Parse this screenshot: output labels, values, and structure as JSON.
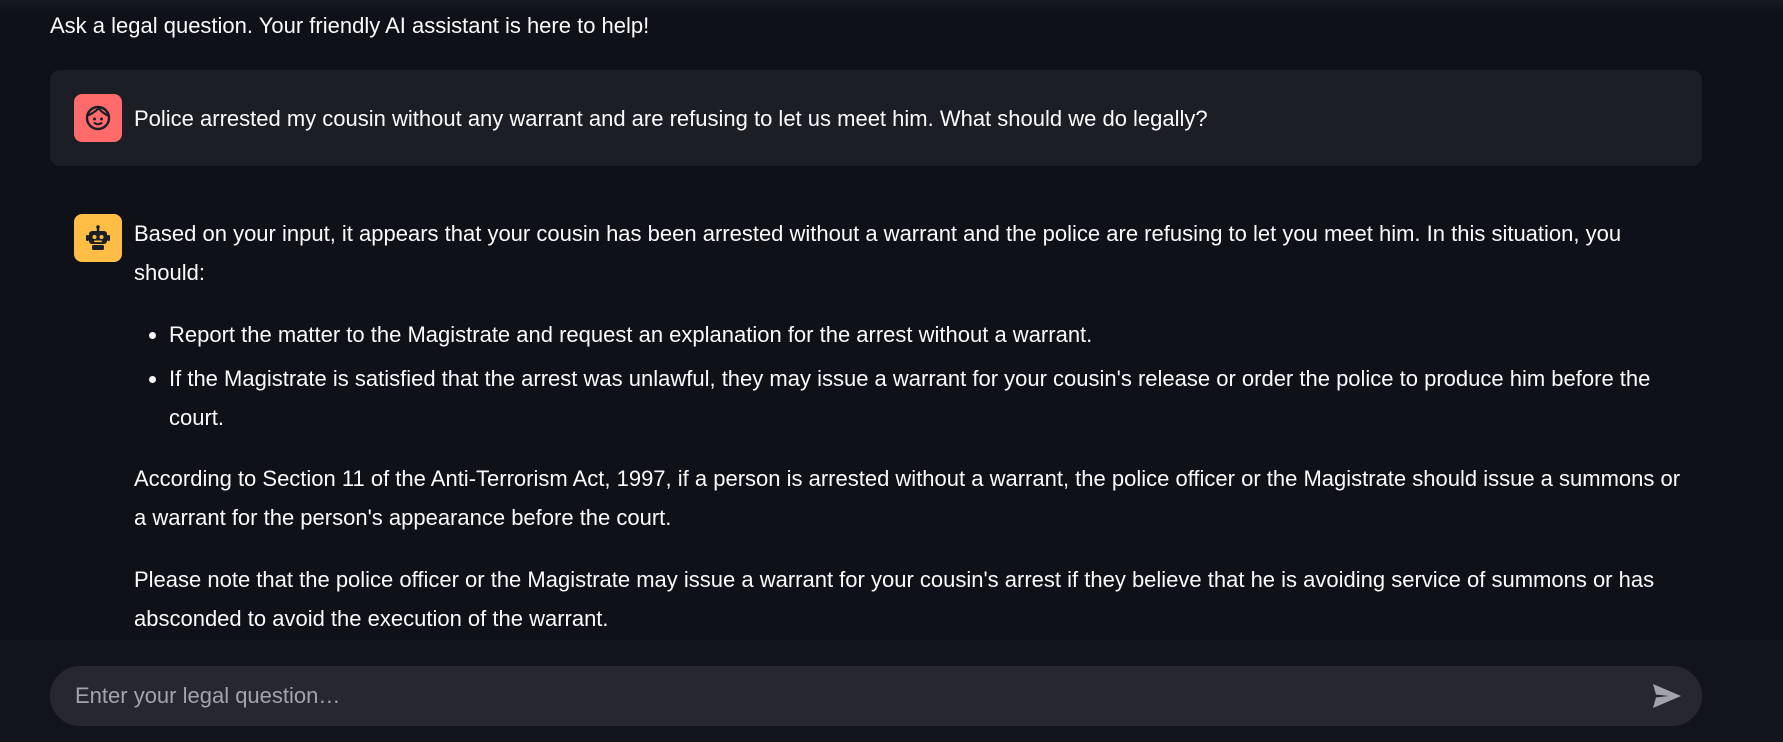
{
  "caption": "Ask a legal question. Your friendly AI assistant is here to help!",
  "messages": {
    "user": {
      "avatar_icon": "user-face-icon",
      "avatar_color": "#ff6b6b",
      "text": "Police arrested my cousin without any warrant and are refusing to let us meet him. What should we do legally?"
    },
    "assistant": {
      "avatar_icon": "robot-icon",
      "avatar_color": "#ffbd45",
      "intro": "Based on your input, it appears that your cousin has been arrested without a warrant and the police are refusing to let you meet him. In this situation, you should:",
      "bullets": [
        "Report the matter to the Magistrate and request an explanation for the arrest without a warrant.",
        "If the Magistrate is satisfied that the arrest was unlawful, they may issue a warrant for your cousin's release or order the police to produce him before the court."
      ],
      "paragraphs": [
        "According to Section 11 of the Anti-Terrorism Act, 1997, if a person is arrested without a warrant, the police officer or the Magistrate should issue a summons or a warrant for the person's appearance before the court.",
        "Please note that the police officer or the Magistrate may issue a warrant for your cousin's arrest if they believe that he is avoiding service of summons or has absconded to avoid the execution of the warrant."
      ]
    }
  },
  "chat_input": {
    "placeholder": "Enter your legal question…",
    "value": "",
    "send_icon": "send-icon"
  },
  "colors": {
    "background": "#0e1117",
    "user_message_bg": "#1c1e25",
    "input_bg": "#262730",
    "text": "#fafafa"
  }
}
